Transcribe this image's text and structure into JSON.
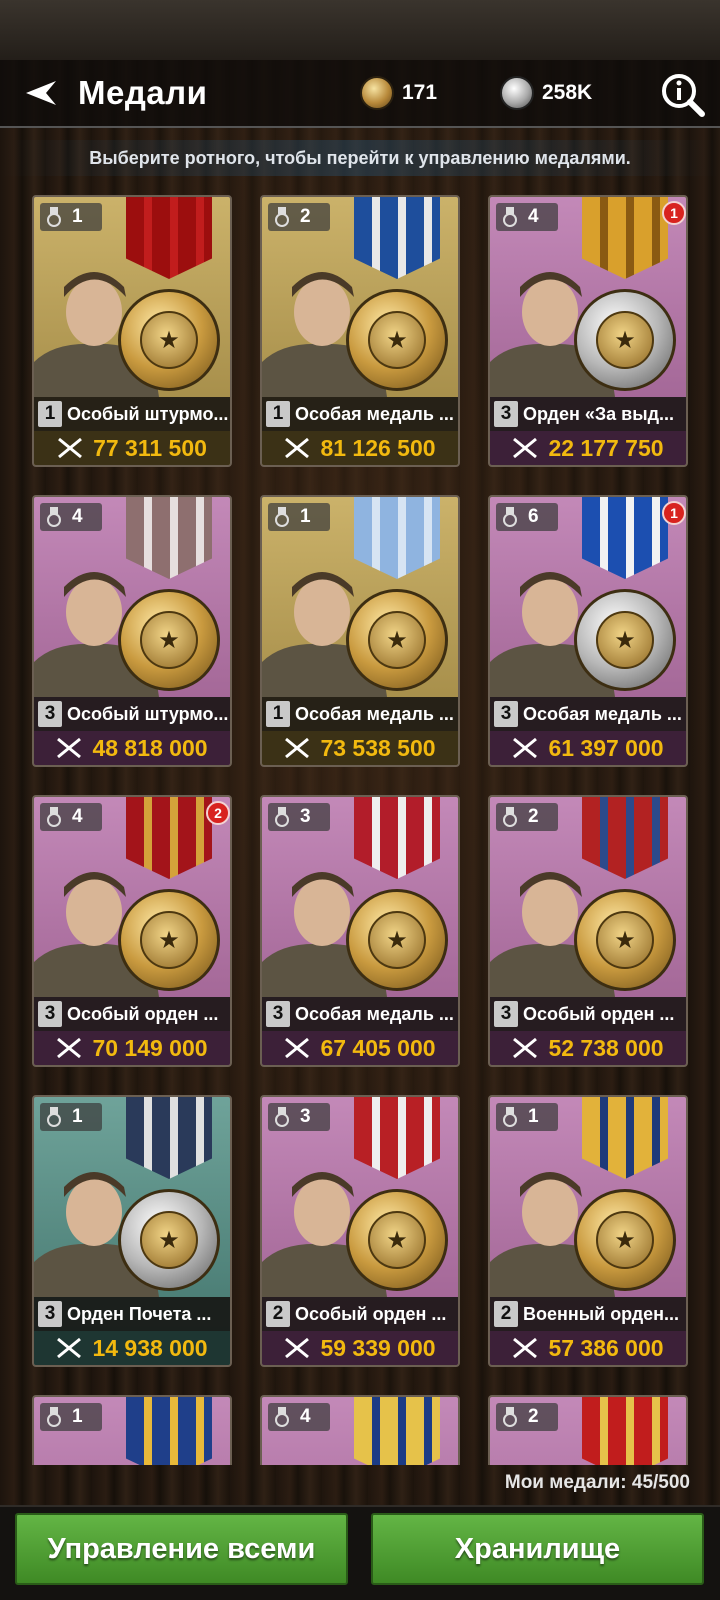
{
  "header": {
    "title": "Медали",
    "medal_currency": "171",
    "silver_currency": "258K"
  },
  "hint": "Выберите ротного, чтобы перейти к управлению медалями.",
  "cards": [
    {
      "count": "1",
      "grade": "1",
      "name": "Особый штурмо...",
      "price": "77 311 500",
      "badge": "",
      "bg": "gold",
      "ribbon": [
        "#9c0e0e",
        "#c11d1d"
      ],
      "medal": "gold-m"
    },
    {
      "count": "2",
      "grade": "1",
      "name": "Особая медаль ...",
      "price": "81 126 500",
      "bg": "gold",
      "badge": "",
      "ribbon": [
        "#1e4e9c",
        "#e8e8e8"
      ],
      "medal": "gold-m"
    },
    {
      "count": "4",
      "grade": "3",
      "name": "Орден «За выд...",
      "price": "22 177 750",
      "bg": "pink",
      "badge": "1",
      "ribbon": [
        "#d9a02c",
        "#8a5a12"
      ],
      "medal": "silver-m"
    },
    {
      "count": "4",
      "grade": "3",
      "name": "Особый штурмо...",
      "price": "48 818 000",
      "bg": "pink",
      "badge": "",
      "ribbon": [
        "#8e6f6f",
        "#e6dede"
      ],
      "medal": "gold-m"
    },
    {
      "count": "1",
      "grade": "1",
      "name": "Особая медаль ...",
      "price": "73 538 500",
      "bg": "gold",
      "badge": "",
      "ribbon": [
        "#8fb4e0",
        "#d6e4f3"
      ],
      "medal": "gold-m"
    },
    {
      "count": "6",
      "grade": "3",
      "name": "Особая медаль ...",
      "price": "61 397 000",
      "bg": "pink",
      "badge": "1",
      "ribbon": [
        "#1c4fb0",
        "#f2f2f2"
      ],
      "medal": "silver-m"
    },
    {
      "count": "4",
      "grade": "3",
      "name": "Особый орден ...",
      "price": "70 149 000",
      "bg": "pink",
      "badge": "2",
      "ribbon": [
        "#a3141a",
        "#d4a23a"
      ],
      "medal": "gold-m"
    },
    {
      "count": "3",
      "grade": "3",
      "name": "Особая медаль ...",
      "price": "67 405 000",
      "bg": "pink",
      "badge": "",
      "ribbon": [
        "#b21d2a",
        "#eeeeee"
      ],
      "medal": "gold-m"
    },
    {
      "count": "2",
      "grade": "3",
      "name": "Особый орден ...",
      "price": "52 738 000",
      "bg": "pink",
      "badge": "",
      "ribbon": [
        "#b22222",
        "#2c4a8c"
      ],
      "medal": "gold-m"
    },
    {
      "count": "1",
      "grade": "3",
      "name": "Орден Почета ...",
      "price": "14 938 000",
      "bg": "teal",
      "badge": "",
      "ribbon": [
        "#2a3a5a",
        "#e0e0e0"
      ],
      "medal": "silver-m"
    },
    {
      "count": "3",
      "grade": "2",
      "name": "Особый орден ...",
      "price": "59 339 000",
      "bg": "pink",
      "badge": "",
      "ribbon": [
        "#b82025",
        "#eeeeee"
      ],
      "medal": "gold-m"
    },
    {
      "count": "1",
      "grade": "2",
      "name": "Военный орден...",
      "price": "57 386 000",
      "bg": "pink",
      "badge": "",
      "ribbon": [
        "#e2b23a",
        "#1e3a7a"
      ],
      "medal": "gold-m"
    },
    {
      "count": "1",
      "grade": "",
      "name": "",
      "price": "",
      "bg": "pink",
      "badge": "",
      "ribbon": [
        "#1f3f8a",
        "#e8b93a"
      ],
      "medal": "gold-m"
    },
    {
      "count": "4",
      "grade": "",
      "name": "",
      "price": "",
      "bg": "pink",
      "badge": "",
      "ribbon": [
        "#e6c24a",
        "#1c3c86"
      ],
      "medal": "gold-m"
    },
    {
      "count": "2",
      "grade": "",
      "name": "",
      "price": "",
      "bg": "pink",
      "badge": "",
      "ribbon": [
        "#c11d1d",
        "#e6c24a"
      ],
      "medal": "gold-m"
    }
  ],
  "footer": {
    "medal_count": "Мои медали: 45/500",
    "manage_all": "Управление всеми",
    "storage": "Хранилище"
  }
}
